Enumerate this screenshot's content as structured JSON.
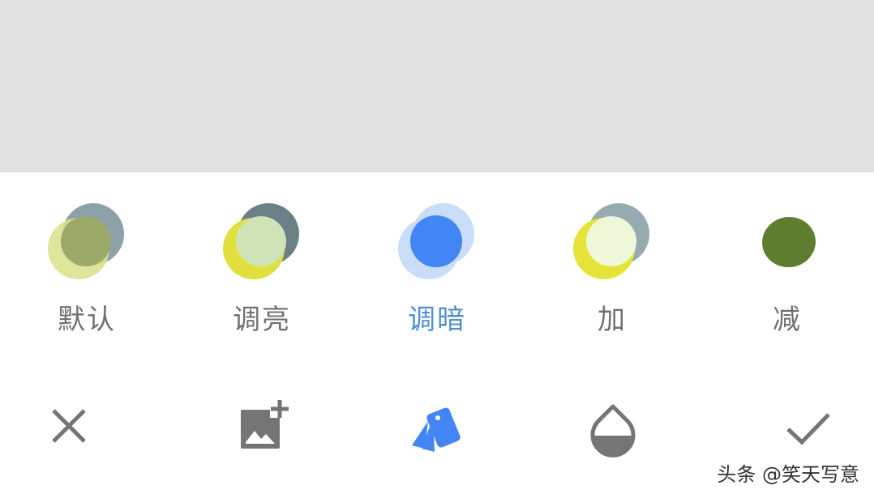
{
  "blend_modes": [
    {
      "label": "默认",
      "selected": false
    },
    {
      "label": "调亮",
      "selected": false
    },
    {
      "label": "调暗",
      "selected": true
    },
    {
      "label": "加",
      "selected": false
    },
    {
      "label": "减",
      "selected": false
    }
  ],
  "toolbar": {
    "icons": [
      "close-icon",
      "add-image-icon",
      "blend-mode-icon",
      "opacity-icon",
      "confirm-icon"
    ]
  },
  "watermark": "头条 @笑天写意",
  "colors": {
    "preview_background": "#e1e1e1",
    "active_label": "#4f8ed6",
    "inactive_label": "#707070",
    "icon_gray": "#757575",
    "accent_blue": "#4285f4"
  }
}
